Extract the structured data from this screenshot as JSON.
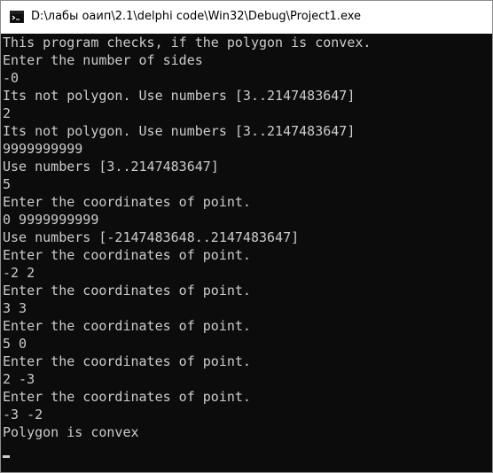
{
  "window": {
    "title": "D:\\лабы оаип\\2.1\\delphi code\\Win32\\Debug\\Project1.exe",
    "icon": "console-app-icon"
  },
  "console": {
    "lines": [
      "This program checks, if the polygon is convex.",
      "Enter the number of sides",
      "-0",
      "Its not polygon. Use numbers [3..2147483647]",
      "2",
      "Its not polygon. Use numbers [3..2147483647]",
      "9999999999",
      "Use numbers [3..2147483647]",
      "5",
      "Enter the coordinates of point.",
      "0 9999999999",
      "Use numbers [-2147483648..2147483647]",
      "Enter the coordinates of point.",
      "-2 2",
      "Enter the coordinates of point.",
      "3 3",
      "Enter the coordinates of point.",
      "5 0",
      "Enter the coordinates of point.",
      "2 -3",
      "Enter the coordinates of point.",
      "-3 -2",
      "Polygon is convex"
    ],
    "text_color": "#cccccc",
    "background_color": "#0c0c0c"
  }
}
